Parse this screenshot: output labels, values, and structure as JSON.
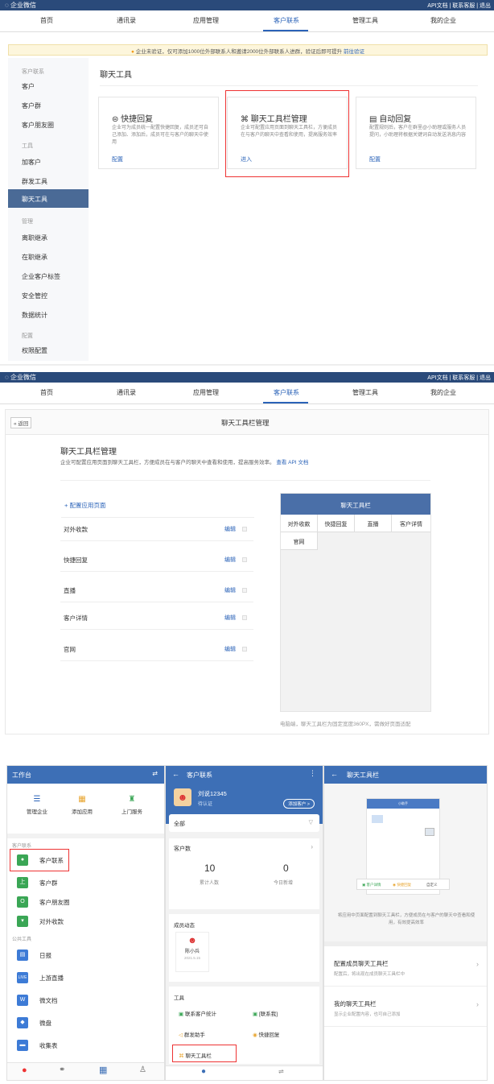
{
  "admin": {
    "brand": "企业微信",
    "top_right": "API文档 | 联系客服 | 退出",
    "nav": [
      "首页",
      "通讯录",
      "应用管理",
      "客户联系",
      "管理工具",
      "我的企业"
    ],
    "active_nav": "客户联系"
  },
  "screen1": {
    "notice_text": "企业未验证，仅可添加1000位外部联系人和邀请2000位外部联系人进群，验证后即可提升",
    "notice_link": "前往验证",
    "sidebar": {
      "sec_customer": "客户联系",
      "customer": "客户",
      "customer_group": "客户群",
      "moments": "客户朋友圈",
      "sec_tools": "工具",
      "add_customer": "加客户",
      "group_tool": "群发工具",
      "chat_tool": "聊天工具",
      "sec_manage": "管理",
      "resign": "离职继承",
      "onjob": "在职继承",
      "corp_tag": "企业客户标签",
      "security": "安全管控",
      "stats": "数据统计",
      "sec_config": "配置",
      "permission": "权限配置"
    },
    "page_title": "聊天工具",
    "cards": [
      {
        "title": "快捷回复",
        "desc": "企业可为成员统一配置快捷回复，成员还可自己添加、添加后，成员可在与客户的聊天中使用",
        "action": "配置"
      },
      {
        "title": "聊天工具栏管理",
        "desc": "企业可配置应用页面到聊天工具栏，方便成员在与客户的聊天中查看和使用，提高服务效率",
        "action": "进入"
      },
      {
        "title": "自动回复",
        "desc": "配置规则后，客户在群里@小助理或服务人员提问，小助理将根据关键词自动发送消息内容",
        "action": "配置"
      }
    ]
  },
  "screen2": {
    "back": "« 返回",
    "header": "聊天工具栏管理",
    "title": "聊天工具栏管理",
    "desc": "企业可配置应用页面到聊天工具栏，方便成员在与客户的聊天中查看和使用，提高服务效率。",
    "desc_link": "查看 API 文档",
    "add": "+  配置应用页面",
    "rows": [
      {
        "name": "对外收款",
        "edit": "编辑"
      },
      {
        "name": "快捷回复",
        "edit": "编辑"
      },
      {
        "name": "直播",
        "edit": "编辑"
      },
      {
        "name": "客户详情",
        "edit": "编辑"
      },
      {
        "name": "官网",
        "edit": "编辑"
      }
    ],
    "preview_header": "聊天工具栏",
    "preview_tabs": [
      "对外收款",
      "快捷回复",
      "直播",
      "客户详情"
    ],
    "preview_tab2": "官网",
    "preview_note": "电脑端，聊天工具栏为固定宽度360PX，需做好页面适配"
  },
  "phone1": {
    "header": "工作台",
    "top_apps": [
      "管理企业",
      "添加应用",
      "上门服务"
    ],
    "sec_customer": "客户联系",
    "customer_items": [
      "客户联系",
      "客户群",
      "客户朋友圈",
      "对外收款"
    ],
    "sec_common": "公共工具",
    "common_items": [
      "日报",
      "上游直播",
      "微文档",
      "微盘",
      "收集表"
    ]
  },
  "phone2": {
    "header": "客户联系",
    "user_name": "刘说12345",
    "user_sub": "待认证",
    "add_btn": "添加客户 >",
    "all_label": "全部",
    "stat_title": "客户数",
    "stat1_val": "10",
    "stat1_label": "累计人数",
    "stat2_val": "0",
    "stat2_label": "今日新增",
    "member_title": "成员动态",
    "member_name": "陈小兵",
    "member_sub": "2021.5.15",
    "tools_title": "工具",
    "tools": [
      "联系客户统计",
      "[联系我]",
      "群发助手",
      "快捷回复"
    ],
    "chat_tool": "聊天工具栏"
  },
  "phone3": {
    "header": "聊天工具栏",
    "mock_title": "小助手",
    "mock_btns": [
      "客户详情",
      "快捷回复",
      "自定义"
    ],
    "tip": "将应用中页面配置到聊天工具栏，方便成员在与客户的聊天中查看和使用，有效提高效率",
    "menu1_title": "配置成员聊天工具栏",
    "menu1_sub": "配置后，将出现在成员聊天工具栏中",
    "menu2_title": "我的聊天工具栏",
    "menu2_sub": "显示企业配置内容，也可自己添加"
  },
  "colors": {
    "topbar": "#2a4a7a",
    "accent": "#2b63b8",
    "phone_blue": "#3d6fb6",
    "highlight_red": "#e33333"
  }
}
